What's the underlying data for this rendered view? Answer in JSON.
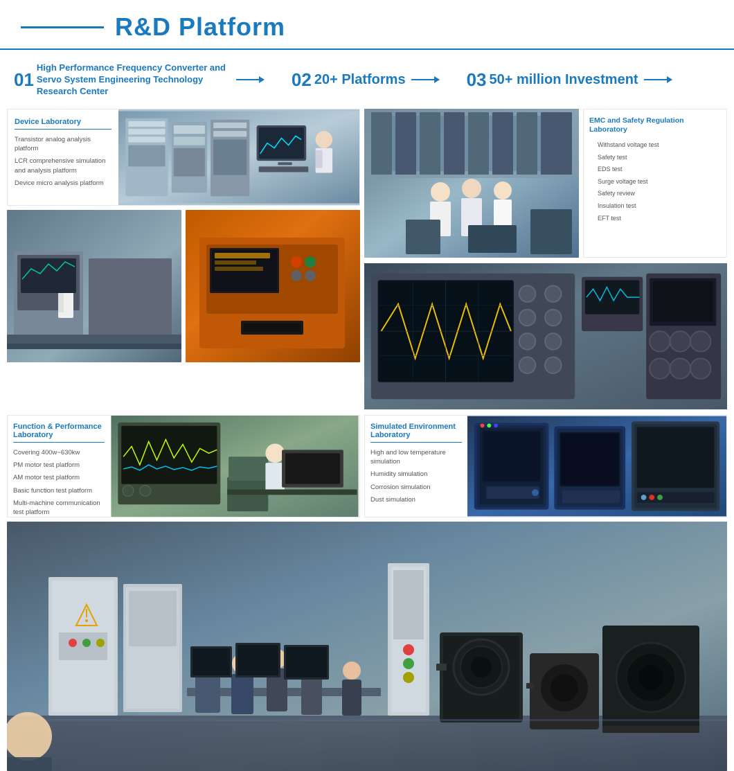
{
  "header": {
    "title": "R&D Platform",
    "accent_color": "#1a7abf"
  },
  "sections": [
    {
      "num": "01",
      "text": "High Performance Frequency Converter and Servo System Engineering Technology Research Center",
      "has_arrow": true
    },
    {
      "num": "02",
      "text": "20+ Platforms",
      "has_arrow": true
    },
    {
      "num": "03",
      "text": "50+ million Investment",
      "has_arrow": true
    }
  ],
  "device_lab": {
    "title": "Device Laboratory",
    "items": [
      "Transistor analog analysis platform",
      "LCR comprehensive simulation and analysis platform",
      "Device micro analysis platform"
    ]
  },
  "emc_lab": {
    "title": "EMC and Safety Regulation Laboratory",
    "items": [
      "Withstand voltage test",
      "Safety test",
      "EDS test",
      "Surge voltage test",
      "Safety review",
      "Insulation test",
      "EFT test"
    ]
  },
  "function_lab": {
    "title": "Function & Performance Laboratory",
    "items": [
      "Covering 400w~630kw",
      "PM motor test platform",
      "AM motor test platform",
      "Basic function test platform",
      "Multi-machine communication test platform"
    ]
  },
  "sim_env_lab": {
    "title": "Simulated Environment Laboratory",
    "items": [
      "High and low temperature simulation",
      "Humidity simulation",
      "Corrosion simulation",
      "Dust simulation"
    ]
  }
}
